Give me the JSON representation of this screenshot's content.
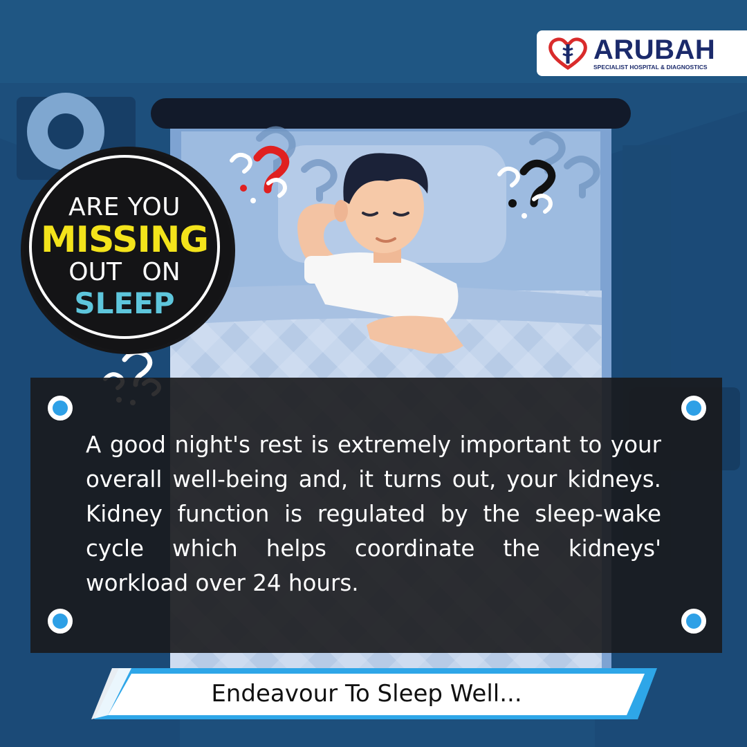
{
  "brand": {
    "name": "ARUBAH",
    "tagline": "SPECIALIST HOSPITAL & DIAGNOSTICS"
  },
  "badge": {
    "line1": "ARE YOU",
    "line2": "MISSING",
    "line3": "OUT ON",
    "line4": "SLEEP"
  },
  "body": {
    "paragraph": "A good night's rest is extremely important to your overall well-being and, it turns out, your kidneys. Kidney function is regulated by the sleep-wake cycle which helps coordinate the kidneys' workload over 24 hours."
  },
  "banner": {
    "text": "Endeavour To Sleep Well..."
  },
  "colors": {
    "background": "#1e4f7a",
    "accent_yellow": "#f3e31b",
    "accent_cyan": "#5ec6dc",
    "dot_blue": "#2ea0e6",
    "brand_navy": "#1b2a6b",
    "brand_red": "#d92b2b"
  },
  "icons": [
    "heart-logo-icon",
    "question-marks-icon",
    "sleeping-man-illustration"
  ]
}
